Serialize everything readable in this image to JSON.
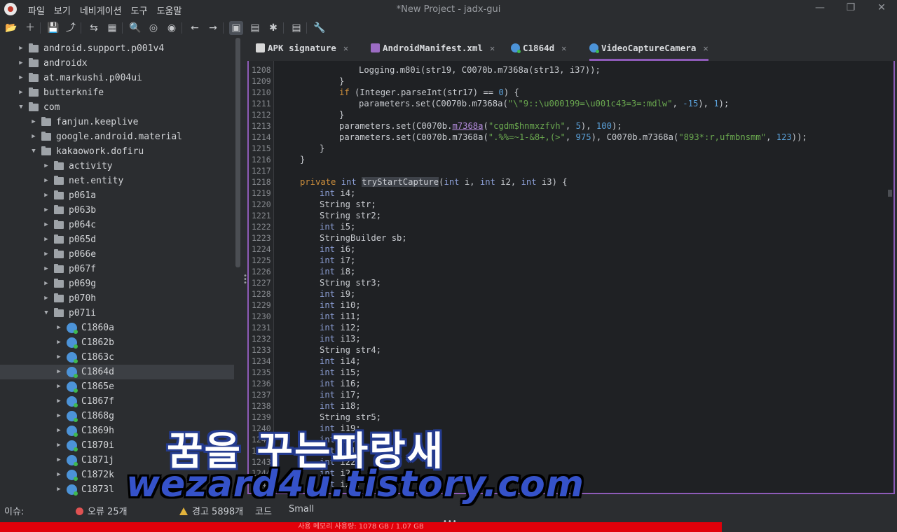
{
  "window": {
    "title": "*New Project - jadx-gui",
    "minimize_glyph": "—",
    "maximize_glyph": "❐",
    "close_glyph": "✕"
  },
  "menu": [
    "파일",
    "보기",
    "네비게이션",
    "도구",
    "도움말"
  ],
  "toolbar": {
    "icons": [
      "open-icon",
      "add-files-icon",
      "save-icon",
      "export-icon",
      "sync-icon",
      "flatten-icon",
      "search-icon",
      "find-usage-icon",
      "find-class-icon",
      "back-icon",
      "forward-icon",
      "deobfuscation-icon",
      "quark-icon",
      "debug-icon",
      "log-icon",
      "settings-icon"
    ],
    "glyphs": [
      "📂",
      "＋",
      "💾",
      "⤴",
      "⇆",
      "▦",
      "🔍",
      "◎",
      "◉",
      "←",
      "→",
      "▣",
      "▤",
      "✱",
      "▤",
      "🔧"
    ]
  },
  "tree": {
    "items": [
      {
        "label": "android.support.p001v4",
        "type": "package",
        "depth": 1,
        "expanded": false
      },
      {
        "label": "androidx",
        "type": "package",
        "depth": 1,
        "expanded": false
      },
      {
        "label": "at.markushi.p004ui",
        "type": "package",
        "depth": 1,
        "expanded": false
      },
      {
        "label": "butterknife",
        "type": "package",
        "depth": 1,
        "expanded": false
      },
      {
        "label": "com",
        "type": "package",
        "depth": 1,
        "expanded": true
      },
      {
        "label": "fanjun.keeplive",
        "type": "package",
        "depth": 2,
        "expanded": false
      },
      {
        "label": "google.android.material",
        "type": "package",
        "depth": 2,
        "expanded": false
      },
      {
        "label": "kakaowork.dofiru",
        "type": "package",
        "depth": 2,
        "expanded": true
      },
      {
        "label": "activity",
        "type": "package",
        "depth": 3,
        "expanded": false
      },
      {
        "label": "net.entity",
        "type": "package",
        "depth": 3,
        "expanded": false
      },
      {
        "label": "p061a",
        "type": "package",
        "depth": 3,
        "expanded": false
      },
      {
        "label": "p063b",
        "type": "package",
        "depth": 3,
        "expanded": false
      },
      {
        "label": "p064c",
        "type": "package",
        "depth": 3,
        "expanded": false
      },
      {
        "label": "p065d",
        "type": "package",
        "depth": 3,
        "expanded": false
      },
      {
        "label": "p066e",
        "type": "package",
        "depth": 3,
        "expanded": false
      },
      {
        "label": "p067f",
        "type": "package",
        "depth": 3,
        "expanded": false
      },
      {
        "label": "p069g",
        "type": "package",
        "depth": 3,
        "expanded": false
      },
      {
        "label": "p070h",
        "type": "package",
        "depth": 3,
        "expanded": false
      },
      {
        "label": "p071i",
        "type": "package",
        "depth": 3,
        "expanded": true
      },
      {
        "label": "C1860a",
        "type": "class",
        "depth": 4,
        "expanded": false
      },
      {
        "label": "C1862b",
        "type": "class",
        "depth": 4,
        "expanded": false
      },
      {
        "label": "C1863c",
        "type": "class",
        "depth": 4,
        "expanded": false
      },
      {
        "label": "C1864d",
        "type": "class",
        "depth": 4,
        "expanded": false,
        "selected": true
      },
      {
        "label": "C1865e",
        "type": "class",
        "depth": 4,
        "expanded": false
      },
      {
        "label": "C1867f",
        "type": "class",
        "depth": 4,
        "expanded": false
      },
      {
        "label": "C1868g",
        "type": "class",
        "depth": 4,
        "expanded": false
      },
      {
        "label": "C1869h",
        "type": "class",
        "depth": 4,
        "expanded": false
      },
      {
        "label": "C1870i",
        "type": "class",
        "depth": 4,
        "expanded": false
      },
      {
        "label": "C1871j",
        "type": "class",
        "depth": 4,
        "expanded": false
      },
      {
        "label": "C1872k",
        "type": "class",
        "depth": 4,
        "expanded": false
      },
      {
        "label": "C1873l",
        "type": "class",
        "depth": 4,
        "expanded": false
      }
    ]
  },
  "tabs": [
    {
      "label": "APK signature",
      "icon": "apk-icon"
    },
    {
      "label": "AndroidManifest.xml",
      "icon": "xml-icon"
    },
    {
      "label": "C1864d",
      "icon": "class-icon"
    },
    {
      "label": "VideoCaptureCamera",
      "icon": "class-icon",
      "active": true
    }
  ],
  "tab_close": "✕",
  "code_lines": [
    {
      "n": "1208",
      "indent": 16,
      "tokens": [
        [
          "t",
          "Logging.m80i(str19, C0070b.m7368a(str13, i37));"
        ]
      ]
    },
    {
      "n": "1209",
      "indent": 12,
      "tokens": [
        [
          "t",
          "}"
        ]
      ]
    },
    {
      "n": "1210",
      "indent": 12,
      "tokens": [
        [
          "kw",
          "if"
        ],
        [
          "t",
          " (Integer.parseInt(str17) == "
        ],
        [
          "num",
          "0"
        ],
        [
          "t",
          ") {"
        ]
      ]
    },
    {
      "n": "1211",
      "indent": 16,
      "tokens": [
        [
          "t",
          "parameters.set(C0070b.m7368a("
        ],
        [
          "str",
          "\"\\\"9::\\u000199=\\u001c43=3=:mdlw\""
        ],
        [
          "t",
          ", "
        ],
        [
          "num",
          "-15"
        ],
        [
          "t",
          "), "
        ],
        [
          "num",
          "1"
        ],
        [
          "t",
          ");"
        ]
      ]
    },
    {
      "n": "1212",
      "indent": 12,
      "tokens": [
        [
          "t",
          "}"
        ]
      ]
    },
    {
      "n": "1213",
      "indent": 12,
      "tokens": [
        [
          "t",
          "parameters.set(C0070b."
        ],
        [
          "ul",
          "m7368a"
        ],
        [
          "t",
          "("
        ],
        [
          "str",
          "\"cgdm$hnmxzfvh\""
        ],
        [
          "t",
          ", "
        ],
        [
          "num",
          "5"
        ],
        [
          "t",
          "), "
        ],
        [
          "num",
          "100"
        ],
        [
          "t",
          ");"
        ]
      ]
    },
    {
      "n": "1214",
      "indent": 12,
      "tokens": [
        [
          "t",
          "parameters.set(C0070b.m7368a("
        ],
        [
          "str",
          "\".%%=~1-&8+,(>\""
        ],
        [
          "t",
          ", "
        ],
        [
          "num",
          "975"
        ],
        [
          "t",
          "), C0070b.m7368a("
        ],
        [
          "str",
          "\"893*:r,ufmbnsmm\""
        ],
        [
          "t",
          ", "
        ],
        [
          "num",
          "123"
        ],
        [
          "t",
          "));"
        ]
      ]
    },
    {
      "n": "1215",
      "indent": 8,
      "tokens": [
        [
          "t",
          "}"
        ]
      ]
    },
    {
      "n": "1216",
      "indent": 4,
      "tokens": [
        [
          "t",
          "}"
        ]
      ]
    },
    {
      "n": "1217",
      "indent": 0,
      "tokens": []
    },
    {
      "n": "1218",
      "indent": 4,
      "tokens": [
        [
          "kw",
          "private"
        ],
        [
          "t",
          " "
        ],
        [
          "ty",
          "int"
        ],
        [
          "t",
          " "
        ],
        [
          "hl",
          "tryStartCapture"
        ],
        [
          "t",
          "("
        ],
        [
          "ty",
          "int"
        ],
        [
          "t",
          " i, "
        ],
        [
          "ty",
          "int"
        ],
        [
          "t",
          " i2, "
        ],
        [
          "ty",
          "int"
        ],
        [
          "t",
          " i3) {"
        ]
      ]
    },
    {
      "n": "1219",
      "indent": 8,
      "tokens": [
        [
          "ty",
          "int"
        ],
        [
          "t",
          " i4;"
        ]
      ]
    },
    {
      "n": "1220",
      "indent": 8,
      "tokens": [
        [
          "t",
          "String str;"
        ]
      ]
    },
    {
      "n": "1221",
      "indent": 8,
      "tokens": [
        [
          "t",
          "String str2;"
        ]
      ]
    },
    {
      "n": "1222",
      "indent": 8,
      "tokens": [
        [
          "ty",
          "int"
        ],
        [
          "t",
          " i5;"
        ]
      ]
    },
    {
      "n": "1223",
      "indent": 8,
      "tokens": [
        [
          "t",
          "StringBuilder sb;"
        ]
      ]
    },
    {
      "n": "1224",
      "indent": 8,
      "tokens": [
        [
          "ty",
          "int"
        ],
        [
          "t",
          " i6;"
        ]
      ]
    },
    {
      "n": "1225",
      "indent": 8,
      "tokens": [
        [
          "ty",
          "int"
        ],
        [
          "t",
          " i7;"
        ]
      ]
    },
    {
      "n": "1226",
      "indent": 8,
      "tokens": [
        [
          "ty",
          "int"
        ],
        [
          "t",
          " i8;"
        ]
      ]
    },
    {
      "n": "1227",
      "indent": 8,
      "tokens": [
        [
          "t",
          "String str3;"
        ]
      ]
    },
    {
      "n": "1228",
      "indent": 8,
      "tokens": [
        [
          "ty",
          "int"
        ],
        [
          "t",
          " i9;"
        ]
      ]
    },
    {
      "n": "1229",
      "indent": 8,
      "tokens": [
        [
          "ty",
          "int"
        ],
        [
          "t",
          " i10;"
        ]
      ]
    },
    {
      "n": "1230",
      "indent": 8,
      "tokens": [
        [
          "ty",
          "int"
        ],
        [
          "t",
          " i11;"
        ]
      ]
    },
    {
      "n": "1231",
      "indent": 8,
      "tokens": [
        [
          "ty",
          "int"
        ],
        [
          "t",
          " i12;"
        ]
      ]
    },
    {
      "n": "1232",
      "indent": 8,
      "tokens": [
        [
          "ty",
          "int"
        ],
        [
          "t",
          " i13;"
        ]
      ]
    },
    {
      "n": "1233",
      "indent": 8,
      "tokens": [
        [
          "t",
          "String str4;"
        ]
      ]
    },
    {
      "n": "1234",
      "indent": 8,
      "tokens": [
        [
          "ty",
          "int"
        ],
        [
          "t",
          " i14;"
        ]
      ]
    },
    {
      "n": "1235",
      "indent": 8,
      "tokens": [
        [
          "ty",
          "int"
        ],
        [
          "t",
          " i15;"
        ]
      ]
    },
    {
      "n": "1236",
      "indent": 8,
      "tokens": [
        [
          "ty",
          "int"
        ],
        [
          "t",
          " i16;"
        ]
      ]
    },
    {
      "n": "1237",
      "indent": 8,
      "tokens": [
        [
          "ty",
          "int"
        ],
        [
          "t",
          " i17;"
        ]
      ]
    },
    {
      "n": "1238",
      "indent": 8,
      "tokens": [
        [
          "ty",
          "int"
        ],
        [
          "t",
          " i18;"
        ]
      ]
    },
    {
      "n": "1239",
      "indent": 8,
      "tokens": [
        [
          "t",
          "String str5;"
        ]
      ]
    },
    {
      "n": "1240",
      "indent": 8,
      "tokens": [
        [
          "ty",
          "int"
        ],
        [
          "t",
          " i19;"
        ]
      ]
    },
    {
      "n": "1241",
      "indent": 8,
      "tokens": [
        [
          "ty",
          "int"
        ],
        [
          "t",
          " i20;"
        ]
      ]
    },
    {
      "n": "1242",
      "indent": 8,
      "tokens": [
        [
          "ty",
          "int"
        ],
        [
          "t",
          " i21;"
        ]
      ]
    },
    {
      "n": "1243",
      "indent": 8,
      "tokens": [
        [
          "ty",
          "int"
        ],
        [
          "t",
          " i22;"
        ]
      ]
    },
    {
      "n": "1244",
      "indent": 8,
      "tokens": [
        [
          "ty",
          "int"
        ],
        [
          "t",
          " i23;"
        ]
      ]
    },
    {
      "n": "1245",
      "indent": 8,
      "tokens": [
        [
          "ty",
          "int"
        ],
        [
          "t",
          " i24;"
        ]
      ]
    }
  ],
  "status": {
    "issues_label": "이슈:",
    "errors": "오류 25개",
    "warnings": "경고 5898개",
    "code_label": "코드",
    "small_label": "Small",
    "dots": "•••"
  },
  "memory_bar": {
    "text": "사용 메모리 사용량: 1078 GB / 1.07 GB",
    "color": "#e0000a"
  },
  "watermark": {
    "korean": "꿈을 꾸는파랑새",
    "url": "wezard4u.tistory.com"
  },
  "colors": {
    "accent": "#8e5bb8",
    "keyword": "#cc8e3c",
    "type": "#8c9fd6",
    "string": "#6aa84f",
    "number": "#5aa0d8"
  }
}
